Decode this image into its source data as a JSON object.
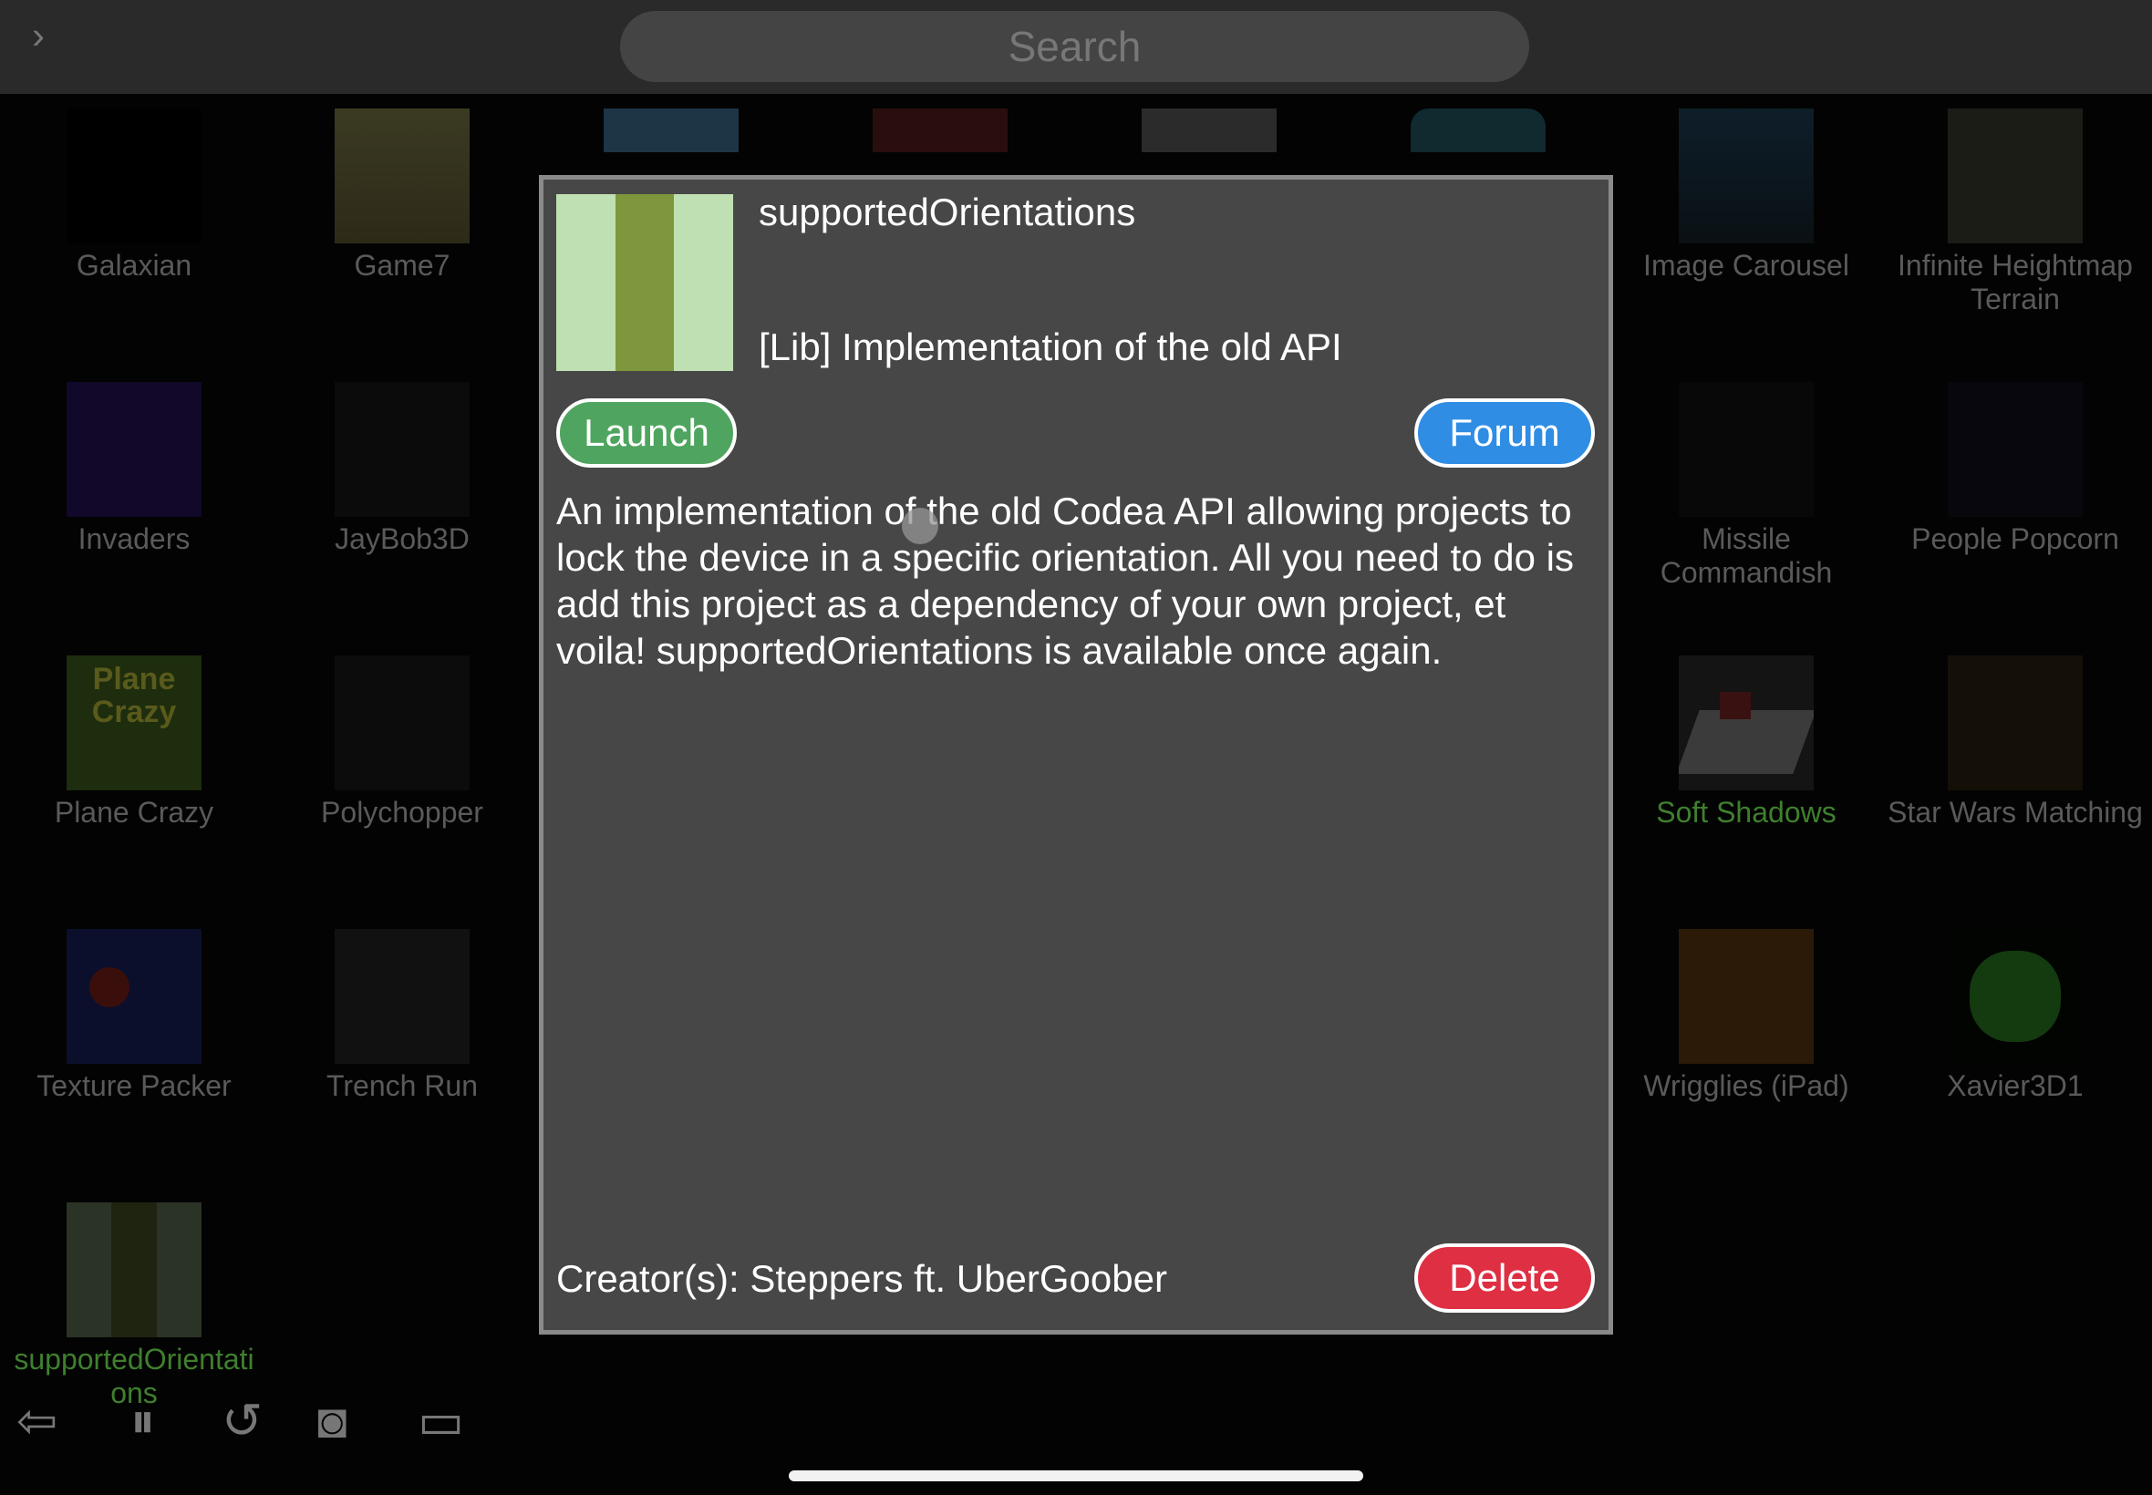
{
  "search": {
    "placeholder": "Search"
  },
  "projects": [
    {
      "label": "Galaxian",
      "thumb_icon": "galaxian-thumbnail"
    },
    {
      "label": "Game7",
      "thumb_icon": "game7-thumbnail"
    },
    {
      "label": "Image Carousel",
      "thumb_icon": "image-carousel-thumbnail"
    },
    {
      "label": "Infinite Heightmap Terrain",
      "thumb_icon": "terrain-thumbnail"
    },
    {
      "label": "Invaders",
      "thumb_icon": "invaders-thumbnail"
    },
    {
      "label": "JayBob3D",
      "thumb_icon": "jaybob3d-thumbnail"
    },
    {
      "label": "Missile Commandish",
      "thumb_icon": "missile-thumbnail"
    },
    {
      "label": "People Popcorn",
      "thumb_icon": "people-popcorn-thumbnail"
    },
    {
      "label": "Plane Crazy",
      "thumb_icon": "plane-crazy-thumbnail",
      "thumb_text": "Plane Crazy"
    },
    {
      "label": "Polychopper",
      "thumb_icon": "polychopper-thumbnail"
    },
    {
      "label": "Soft Shadows",
      "thumb_icon": "soft-shadows-thumbnail",
      "highlight": true
    },
    {
      "label": "Star Wars Matching",
      "thumb_icon": "star-wars-matching-thumbnail"
    },
    {
      "label": "Texture Packer",
      "thumb_icon": "texture-packer-thumbnail"
    },
    {
      "label": "Trench Run",
      "thumb_icon": "trench-run-thumbnail"
    },
    {
      "label": "Wrigglies (iPad)",
      "thumb_icon": "wrigglies-thumbnail"
    },
    {
      "label": "Xavier3D1",
      "thumb_icon": "xavier3d1-thumbnail"
    },
    {
      "label": "supportedOrientati ons",
      "thumb_icon": "supported-orientations-thumbnail",
      "highlight": true
    }
  ],
  "dialog": {
    "title": "supportedOrientations",
    "subtitle": "[Lib] Implementation of the old API",
    "launch_label": "Launch",
    "forum_label": "Forum",
    "description": "An implementation of the old Codea API allowing projects to lock the device in a specific orientation. All you need to do is add this project as a dependency of your own project, et voila! supportedOrientations is available once again.",
    "creator": "Creator(s): Steppers ft. UberGoober",
    "delete_label": "Delete"
  },
  "toolbar_icons": [
    "back-arrow-icon",
    "pause-icon",
    "restart-icon",
    "camera-icon",
    "video-camera-icon"
  ],
  "colors": {
    "launch": "#4fa55f",
    "forum": "#2f8de4",
    "delete": "#df2f43",
    "dialog_bg": "#474747",
    "highlight_label": "#3f7f2e"
  }
}
